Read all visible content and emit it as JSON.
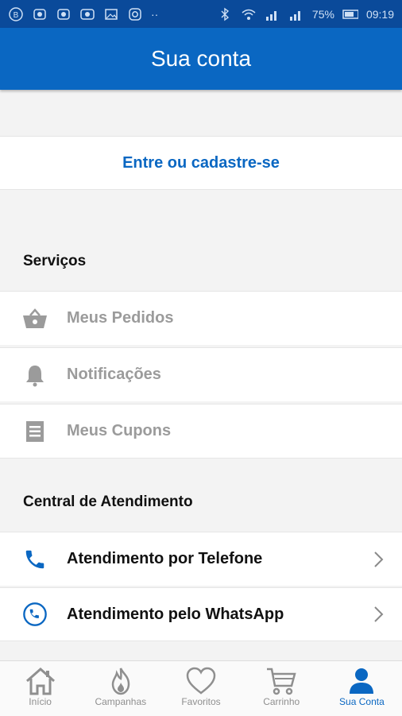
{
  "status_bar": {
    "battery": "75%",
    "time": "09:19",
    "dots": "··"
  },
  "header": {
    "title": "Sua conta"
  },
  "login": {
    "label": "Entre ou cadastre-se"
  },
  "services": {
    "title": "Serviços",
    "items": [
      {
        "label": "Meus Pedidos",
        "icon": "basket-icon"
      },
      {
        "label": "Notificações",
        "icon": "bell-icon"
      },
      {
        "label": "Meus Cupons",
        "icon": "coupon-icon"
      }
    ]
  },
  "support": {
    "title": "Central de Atendimento",
    "items": [
      {
        "label": "Atendimento por Telefone",
        "icon": "phone-icon"
      },
      {
        "label": "Atendimento pelo WhatsApp",
        "icon": "whatsapp-icon"
      }
    ]
  },
  "tabs": [
    {
      "label": "Início",
      "icon": "home-icon"
    },
    {
      "label": "Campanhas",
      "icon": "flame-icon"
    },
    {
      "label": "Favoritos",
      "icon": "heart-icon"
    },
    {
      "label": "Carrinho",
      "icon": "cart-icon"
    },
    {
      "label": "Sua Conta",
      "icon": "user-icon"
    }
  ],
  "colors": {
    "brand": "#0a67c2",
    "status": "#0a4a9a",
    "muted": "#9b9b9b"
  }
}
